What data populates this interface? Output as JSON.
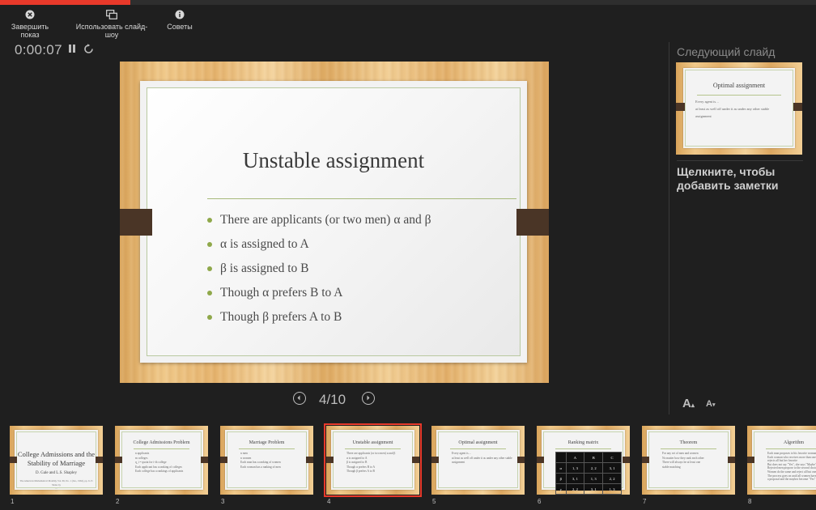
{
  "progress": 0.4,
  "toolbar": {
    "end_show": "Завершить показ",
    "use_slideshow": "Использовать слайд-шоу",
    "tips": "Советы"
  },
  "timer": "0:00:07",
  "slide": {
    "title": "Unstable assignment",
    "bullets": [
      "There are applicants (or two men) α and β",
      "α is assigned to A",
      "β is assigned to B",
      "Though α prefers B to A",
      "Though β prefers A to B"
    ]
  },
  "nav": {
    "counter": "4/10"
  },
  "next_panel": {
    "label": "Следующий слайд",
    "thumb_title": "Optimal assignment",
    "thumb_line1": "Every agent is…",
    "thumb_line2": "at least as well off under it as under any other stable",
    "thumb_line3": "assignment"
  },
  "notes": "Щелкните, чтобы добавить заметки",
  "font_controls": {
    "increase": "A",
    "decrease": "A"
  },
  "thumbnails": [
    {
      "num": "1",
      "title": "College Admissions and the Stability of Marriage",
      "authors": "D. Gale and L.S. Shapley",
      "citation": "The American Mathematical Monthly, Vol. 69, No. 1 (Jan., 1962), pp. 9-15",
      "presenter1": "Slides by",
      "presenter2": "...",
      "presenter3": "..."
    },
    {
      "num": "2",
      "title": "College Admissions Problem",
      "lines": [
        "n applicants",
        "m colleges",
        "q_i = quota for i-th college",
        "Each applicant has a ranking of colleges",
        "Each college has a rankings of applicants"
      ]
    },
    {
      "num": "3",
      "title": "Marriage Problem",
      "lines": [
        "n men",
        "n women",
        "Each man has a ranking of women",
        "Each woman has a ranking of men"
      ]
    },
    {
      "num": "4",
      "title": "Unstable assignment",
      "lines": [
        "There are applicants (or two men) α and β",
        "α is assigned to A",
        "β is assigned to B",
        "Though α prefers B to A",
        "Though β prefers A to B"
      ]
    },
    {
      "num": "5",
      "title": "Optimal assignment",
      "lines": [
        "Every agent is…",
        "at least as well off under it as under any other stable",
        "assignment"
      ]
    },
    {
      "num": "6",
      "title": "Ranking matrix",
      "matrix_header": [
        "",
        "A",
        "B",
        "C"
      ],
      "matrix_rows": [
        [
          "α",
          "1, 3",
          "2, 2",
          "3, 1"
        ],
        [
          "β",
          "3, 1",
          "1, 3",
          "2, 2"
        ],
        [
          "γ",
          "2, 2",
          "3, 1",
          "1, 3"
        ]
      ]
    },
    {
      "num": "7",
      "title": "Theorem",
      "lines": [
        "For any set of men and women",
        "No matter how they rank each other",
        "There will always be at least one",
        "stable matching"
      ]
    },
    {
      "num": "8",
      "title": "Algorithm",
      "lines": [
        "Each man proposes to his favorite woman",
        "Each woman who receives more than one proposal",
        "rejects all but her favorite",
        "But does not say \"Yes\", she says \"Maybe\"",
        "Rejected men propose to the second choice",
        "Women do the same and reject all but one",
        "The process goes on until all women have",
        "a proposal and the maybes become \"Yes\""
      ]
    }
  ]
}
